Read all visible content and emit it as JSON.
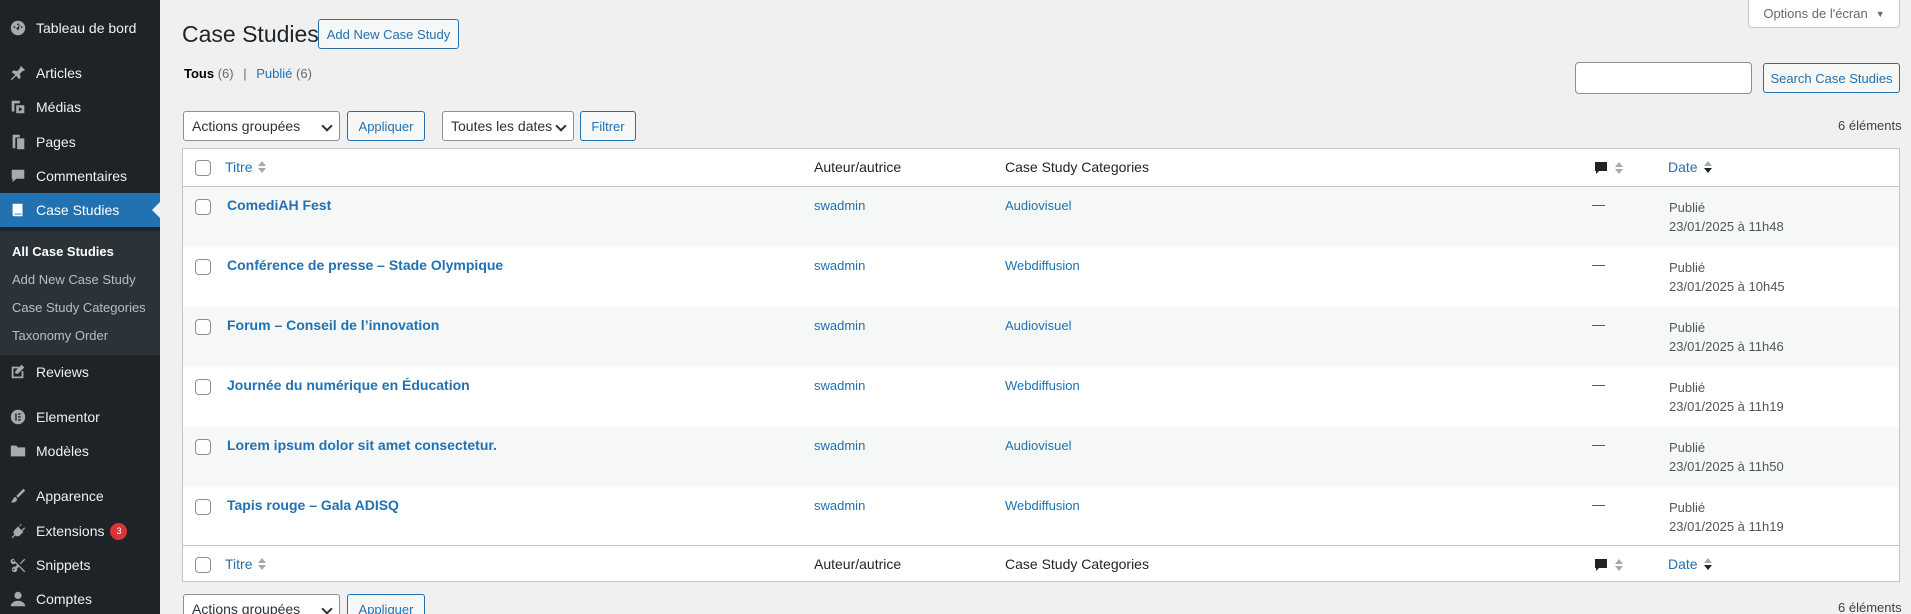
{
  "sidebar": {
    "items": [
      {
        "label": "Tableau de bord",
        "icon": "dashboard-icon"
      },
      {
        "label": "Articles",
        "icon": "pushpin-icon"
      },
      {
        "label": "Médias",
        "icon": "media-icon"
      },
      {
        "label": "Pages",
        "icon": "pages-icon"
      },
      {
        "label": "Commentaires",
        "icon": "comments-icon"
      },
      {
        "label": "Case Studies",
        "icon": "book-icon"
      },
      {
        "label": "Reviews",
        "icon": "edit-icon"
      },
      {
        "label": "Elementor",
        "icon": "elementor-icon"
      },
      {
        "label": "Modèles",
        "icon": "folder-icon"
      },
      {
        "label": "Apparence",
        "icon": "brush-icon"
      },
      {
        "label": "Extensions",
        "icon": "plugin-icon",
        "badge": "3"
      },
      {
        "label": "Snippets",
        "icon": "snippets-icon"
      },
      {
        "label": "Comptes",
        "icon": "user-icon"
      }
    ],
    "submenu": [
      "All Case Studies",
      "Add New Case Study",
      "Case Study Categories",
      "Taxonomy Order"
    ]
  },
  "header": {
    "title": "Case Studies",
    "add_new": "Add New Case Study",
    "screen_options": "Options de l'écran",
    "search_button": "Search Case Studies",
    "search_value": ""
  },
  "views": {
    "all_label": "Tous",
    "all_count": "(6)",
    "sep": "|",
    "published_label": "Publié",
    "published_count": "(6)"
  },
  "toolbar": {
    "bulk_actions": "Actions groupées",
    "apply": "Appliquer",
    "dates": "Toutes les dates",
    "filter": "Filtrer",
    "count": "6 éléments"
  },
  "table": {
    "columns": {
      "title": "Titre",
      "author": "Auteur/autrice",
      "categories": "Case Study Categories",
      "date": "Date"
    },
    "rows": [
      {
        "title": "ComediAH Fest",
        "author": "swadmin",
        "category": "Audiovisuel",
        "comments": "—",
        "status": "Publié",
        "date": "23/01/2025 à 11h48"
      },
      {
        "title": "Conférence de presse – Stade Olympique",
        "author": "swadmin",
        "category": "Webdiffusion",
        "comments": "—",
        "status": "Publié",
        "date": "23/01/2025 à 10h45"
      },
      {
        "title": "Forum – Conseil de l’innovation",
        "author": "swadmin",
        "category": "Audiovisuel",
        "comments": "—",
        "status": "Publié",
        "date": "23/01/2025 à 11h46"
      },
      {
        "title": "Journée du numérique en Éducation",
        "author": "swadmin",
        "category": "Webdiffusion",
        "comments": "—",
        "status": "Publié",
        "date": "23/01/2025 à 11h19"
      },
      {
        "title": "Lorem ipsum dolor sit amet consectetur.",
        "author": "swadmin",
        "category": "Audiovisuel",
        "comments": "—",
        "status": "Publié",
        "date": "23/01/2025 à 11h50"
      },
      {
        "title": "Tapis rouge – Gala ADISQ",
        "author": "swadmin",
        "category": "Webdiffusion",
        "comments": "—",
        "status": "Publié",
        "date": "23/01/2025 à 11h19"
      }
    ]
  },
  "colors": {
    "sidebar_bg": "#1d2327",
    "accent": "#2271b1",
    "page_bg": "#f0f0f1",
    "badge": "#d63638"
  }
}
